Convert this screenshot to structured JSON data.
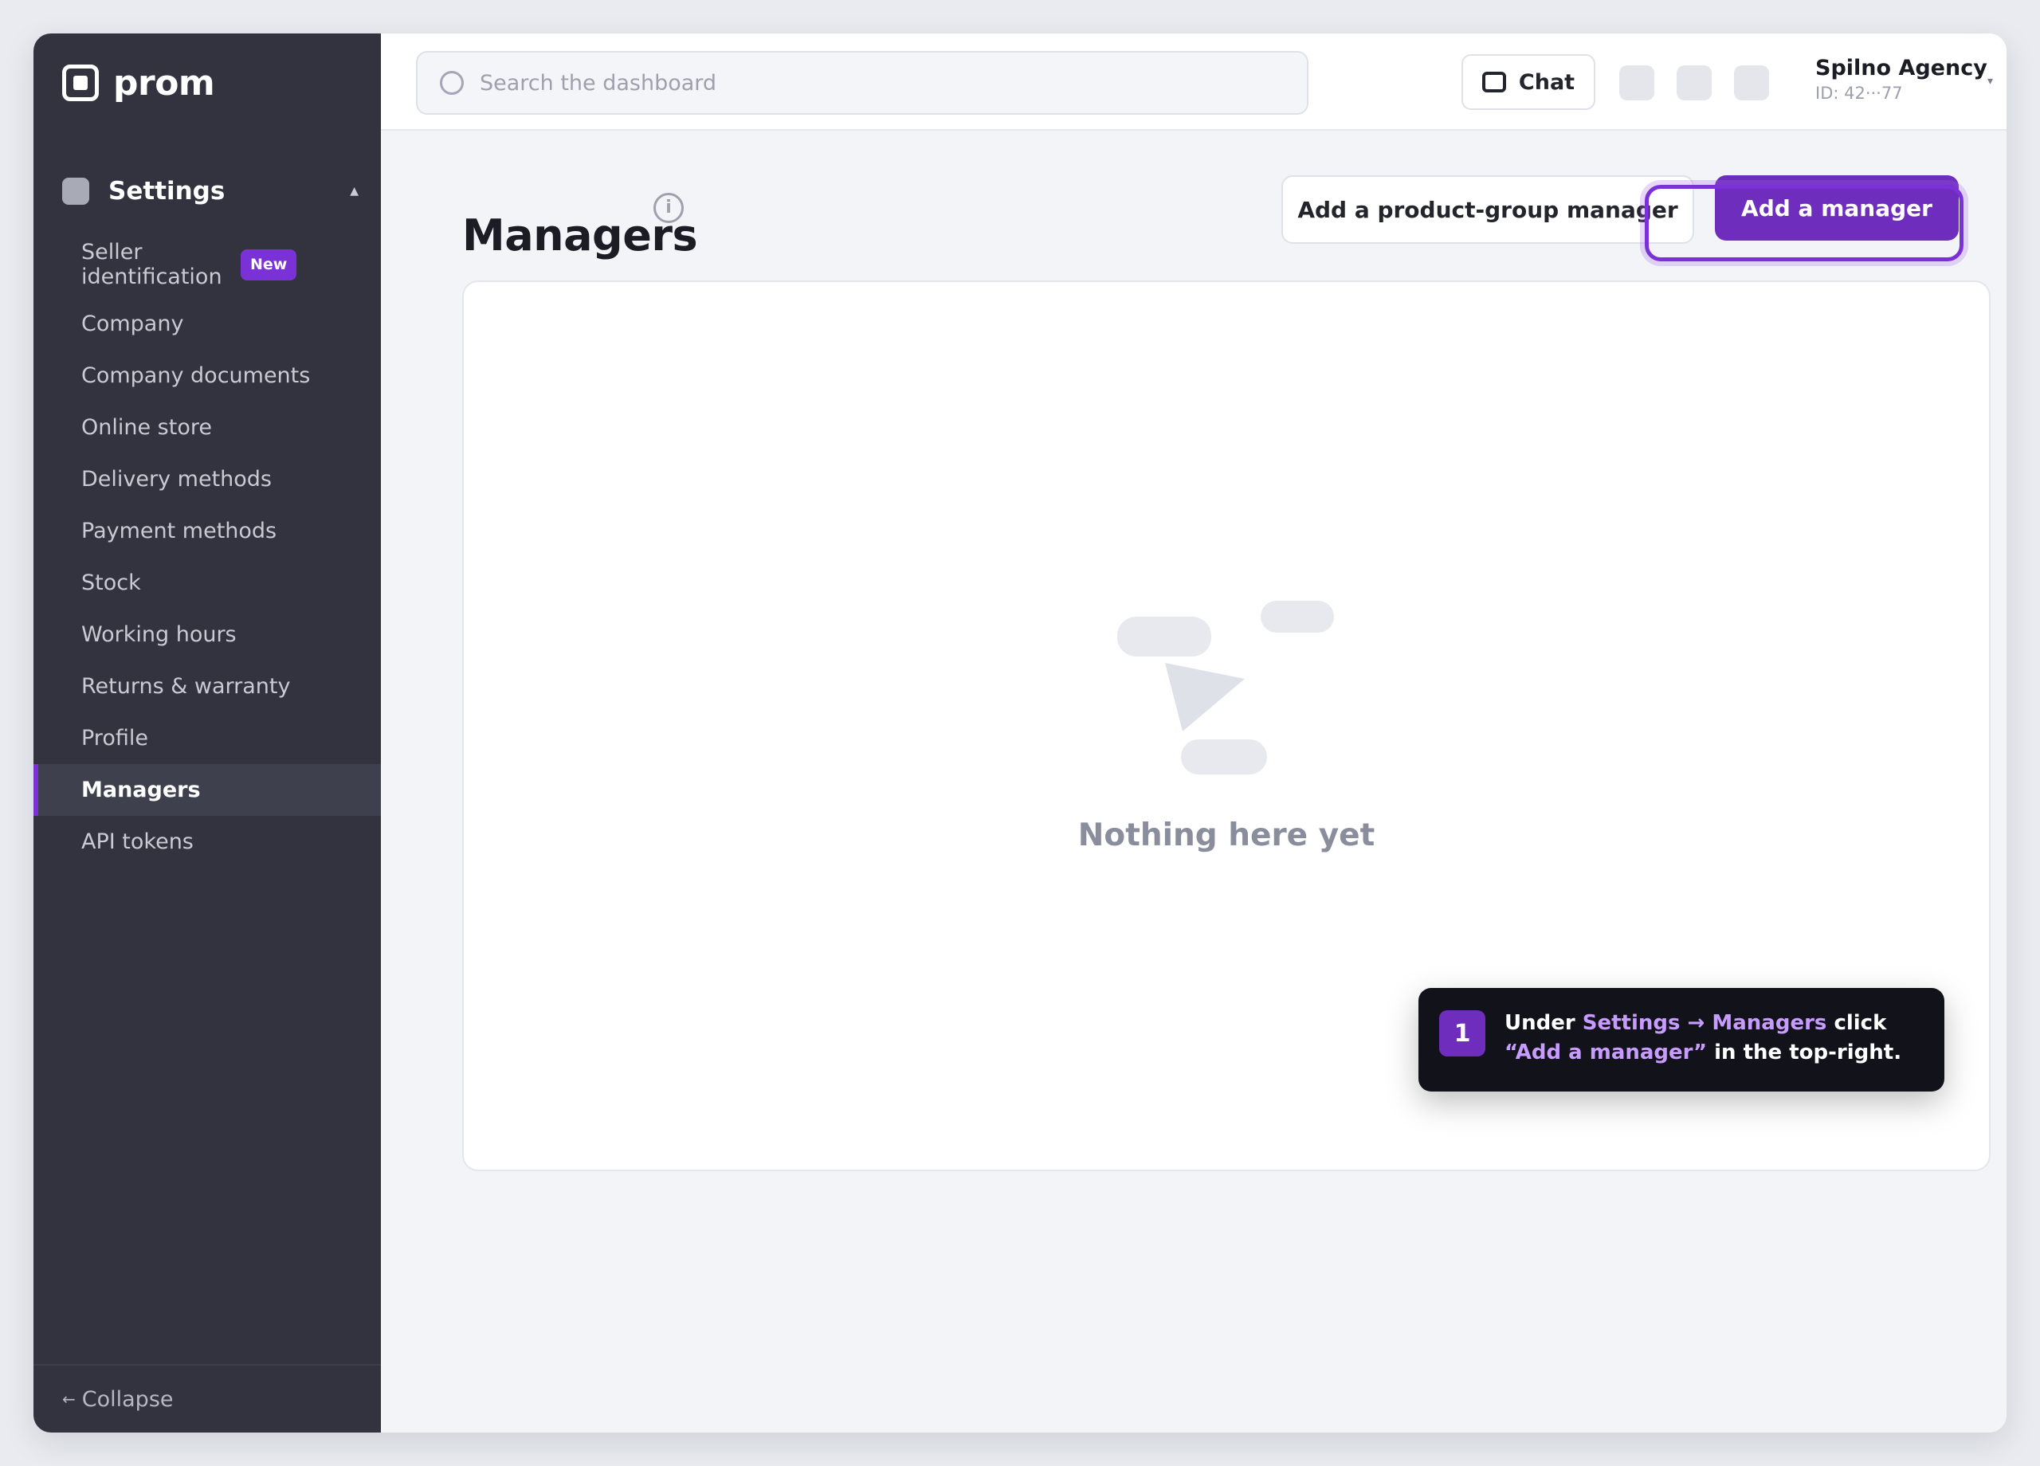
{
  "app": {
    "brand": "prom"
  },
  "sidebar": {
    "section_title": "Settings",
    "section_caret": "▲",
    "items": [
      {
        "label": "Seller identification",
        "badge": "New"
      },
      {
        "label": "Company"
      },
      {
        "label": "Company documents"
      },
      {
        "label": "Online store"
      },
      {
        "label": "Delivery methods"
      },
      {
        "label": "Payment methods"
      },
      {
        "label": "Stock"
      },
      {
        "label": "Working hours"
      },
      {
        "label": "Returns & warranty"
      },
      {
        "label": "Profile"
      },
      {
        "label": "Managers",
        "active": true
      },
      {
        "label": "API tokens"
      }
    ],
    "collapse_arrow": "←",
    "collapse_label": "Collapse"
  },
  "topbar": {
    "search_placeholder": "Search the dashboard",
    "chat_label": "Chat",
    "account_name": "Spilno Agency",
    "account_id": "ID: 42···77",
    "account_caret": "▾"
  },
  "main": {
    "title": "Managers",
    "info_glyph": "i",
    "secondary_button": "Add a product-group manager",
    "primary_button": "Add a manager",
    "empty_state": "Nothing here yet"
  },
  "tooltip": {
    "step": "1",
    "text_1": "Under ",
    "hl_1": "Settings → Managers",
    "text_2": " click ",
    "hl_2": "“Add a manager”",
    "text_3": " in the top-right."
  },
  "colors": {
    "accent": "#6f2dbd",
    "sidebar_bg": "#32333f",
    "tooltip_bg": "#11121a",
    "highlight": "#c89bff"
  }
}
